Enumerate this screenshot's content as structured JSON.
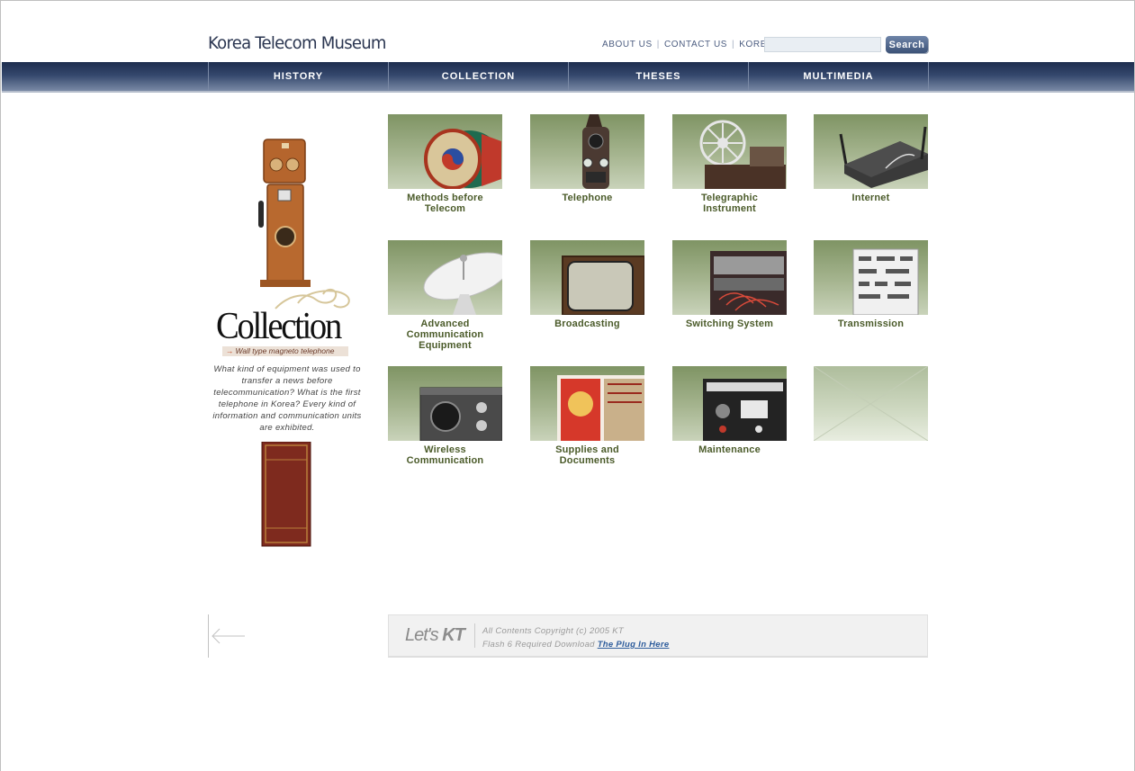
{
  "header": {
    "site_title": "Korea Telecom Museum",
    "utility_links": [
      "ABOUT US",
      "CONTACT US",
      "KOREAN"
    ],
    "search": {
      "value": "",
      "button_label": "Search"
    }
  },
  "main_nav": [
    "HISTORY",
    "COLLECTION",
    "THESES",
    "MULTIMEDIA"
  ],
  "left_panel": {
    "heading": "Collection",
    "caption": "Wall type magneto telephone",
    "intro": "What kind of equipment was used to transfer a news before telecommunication? What is the first telephone in Korea? Every kind of information and communication units are exhibited."
  },
  "collection_items": [
    {
      "label": "Methods before\nTelecom",
      "icon": "drum-icon"
    },
    {
      "label": "Telephone",
      "icon": "telephone-icon"
    },
    {
      "label": "Telegraphic\nInstrument",
      "icon": "telegraph-icon"
    },
    {
      "label": "Internet",
      "icon": "router-icon"
    },
    {
      "label": "Advanced\nCommunication Equipment",
      "icon": "satellite-dish-icon"
    },
    {
      "label": "Broadcasting",
      "icon": "tv-icon"
    },
    {
      "label": "Switching System",
      "icon": "switchboard-icon"
    },
    {
      "label": "Transmission",
      "icon": "transmission-rack-icon"
    },
    {
      "label": "Wireless\nCommunication",
      "icon": "radio-icon"
    },
    {
      "label": "Supplies and\nDocuments",
      "icon": "document-icon"
    },
    {
      "label": "Maintenance",
      "icon": "test-equipment-icon"
    }
  ],
  "footer": {
    "logo_lets": "Let's",
    "logo_kt": "KT",
    "copyright": "All Contents Copyright (c) 2005 KT",
    "flash_notice": "Flash 6 Required Download",
    "plugin_link": "The Plug In Here"
  },
  "colors": {
    "nav_bg": "#1d2d4e",
    "title_text": "#2a3550",
    "tile_label": "#4b5b2a",
    "tile_bg": "#a6b590",
    "link": "#2d5c9c"
  }
}
